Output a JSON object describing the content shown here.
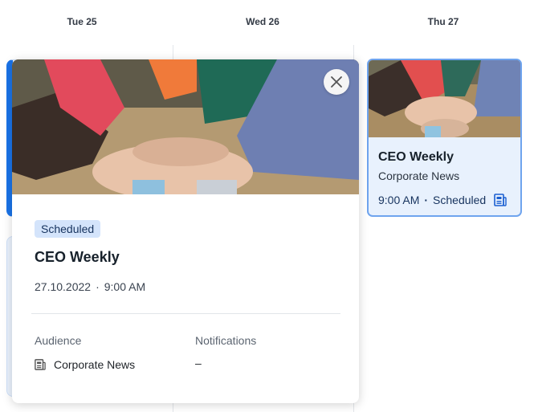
{
  "calendar": {
    "days": [
      "Tue 25",
      "Wed 26",
      "Thu 27"
    ]
  },
  "event_card": {
    "title": "CEO Weekly",
    "subtitle": "Corporate News",
    "time": "9:00 AM",
    "separator": "·",
    "status": "Scheduled",
    "icon": "newspaper-icon"
  },
  "popup": {
    "status_badge": "Scheduled",
    "title": "CEO Weekly",
    "date": "27.10.2022",
    "separator": "·",
    "time": "9:00 AM",
    "audience_label": "Audience",
    "audience_value": "Corporate News",
    "notifications_label": "Notifications",
    "notifications_value": "–",
    "close_icon": "close-icon"
  },
  "colors": {
    "accent": "#1a73e8",
    "badge_bg": "#d4e4fb",
    "card_bg": "#e8f1fd",
    "card_border": "#6fa4ee"
  }
}
